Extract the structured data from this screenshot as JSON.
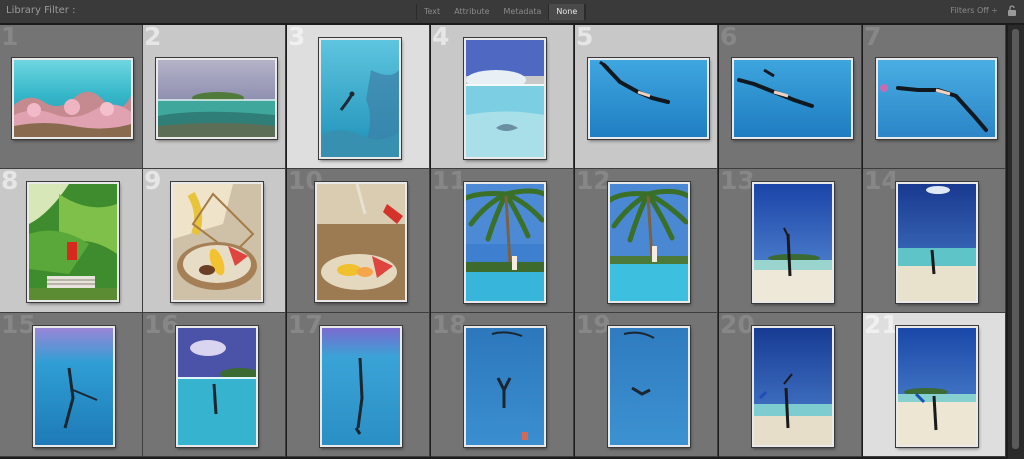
{
  "filter_bar": {
    "label": "Library Filter :",
    "tabs": [
      {
        "label": "Text",
        "active": false
      },
      {
        "label": "Attribute",
        "active": false
      },
      {
        "label": "Metadata",
        "active": false
      },
      {
        "label": "None",
        "active": true
      }
    ],
    "status": "Filters Off ÷"
  },
  "cells": [
    {
      "number": "1",
      "icon": "reef-photo"
    },
    {
      "number": "2",
      "icon": "island-over-under-photo"
    },
    {
      "number": "3",
      "icon": "diver-reef-photo"
    },
    {
      "number": "4",
      "icon": "stingray-over-under-photo"
    },
    {
      "number": "5",
      "icon": "freediver-photo"
    },
    {
      "number": "6",
      "icon": "freediver-photo"
    },
    {
      "number": "7",
      "icon": "freediver-photo"
    },
    {
      "number": "8",
      "icon": "jungle-villa-photo"
    },
    {
      "number": "9",
      "icon": "fruit-platter-photo"
    },
    {
      "number": "10",
      "icon": "fruit-platter-photo"
    },
    {
      "number": "11",
      "icon": "palm-pool-photo"
    },
    {
      "number": "12",
      "icon": "palm-pool-photo"
    },
    {
      "number": "13",
      "icon": "beach-photo"
    },
    {
      "number": "14",
      "icon": "beach-photo"
    },
    {
      "number": "15",
      "icon": "underwater-diver-photo"
    },
    {
      "number": "16",
      "icon": "over-under-diver-photo"
    },
    {
      "number": "17",
      "icon": "underwater-diver-photo"
    },
    {
      "number": "18",
      "icon": "underwater-diver-photo"
    },
    {
      "number": "19",
      "icon": "underwater-diver-photo"
    },
    {
      "number": "20",
      "icon": "beach-fins-photo"
    },
    {
      "number": "21",
      "icon": "beach-fins-photo"
    }
  ]
}
